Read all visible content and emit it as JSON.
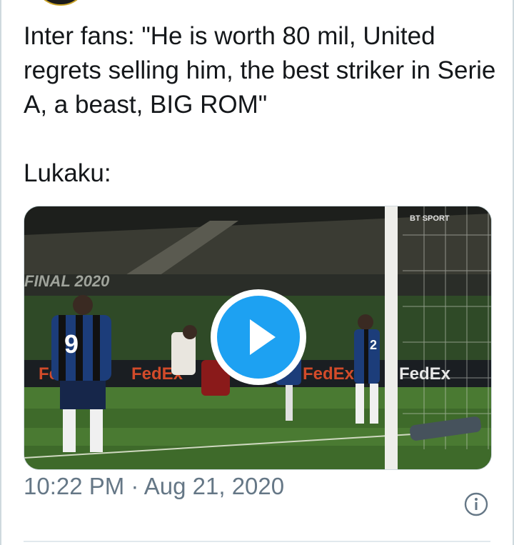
{
  "tweet": {
    "text": "Inter fans: \"He is worth 80 mil, United regrets selling him, the best striker in Serie A, a beast, BIG ROM\"\n\nLukaku:",
    "timestamp_time": "10:22 PM",
    "timestamp_sep": " · ",
    "timestamp_date": "Aug 21, 2020"
  },
  "media": {
    "type": "video",
    "play_icon": "play-icon",
    "banner_text": "FINAL 2020",
    "sponsor": "FedEx",
    "broadcaster": "BT SPORT",
    "shirt_numbers": [
      "9",
      "2"
    ]
  },
  "icons": {
    "info": "info-icon"
  },
  "colors": {
    "accent": "#1da1f2",
    "text": "#14171a",
    "muted": "#657786",
    "border": "#cfd9de"
  }
}
